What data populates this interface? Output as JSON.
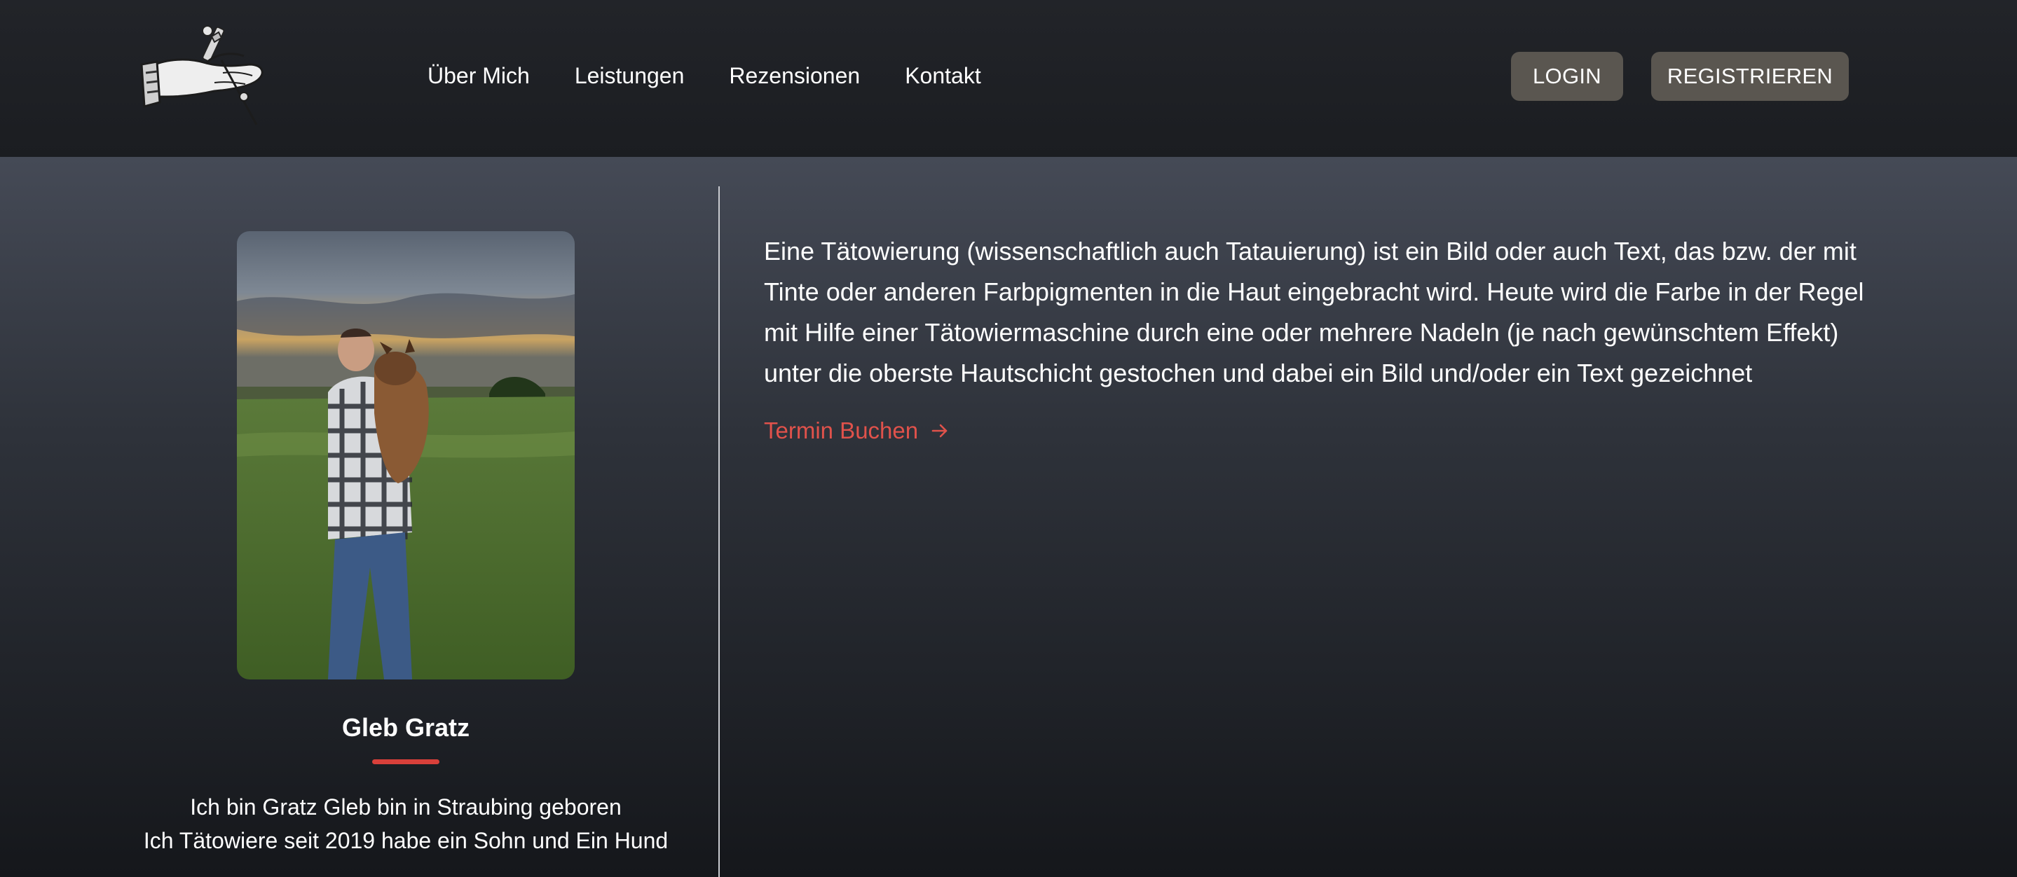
{
  "header": {
    "logo_icon": "tattoo-hand-logo-icon",
    "nav": [
      {
        "label": "Über Mich"
      },
      {
        "label": "Leistungen"
      },
      {
        "label": "Rezensionen"
      },
      {
        "label": "Kontakt"
      }
    ],
    "login_label": "LOGIN",
    "register_label": "REGISTRIEREN"
  },
  "profile": {
    "photo_icon": "artist-photo",
    "name": "Gleb Gratz",
    "bio_lines": [
      "Ich bin Gratz Gleb bin in Straubing geboren",
      "Ich Tätowiere seit 2019 habe ein Sohn und Ein Hund"
    ]
  },
  "about": {
    "lines": [
      "Eine Tätowierung (wissenschaftlich auch Tatauierung) ist ein Bild oder auch Text, das bzw. der mit",
      "Tinte oder anderen Farbpigmenten in die Haut eingebracht wird. Heute wird die Farbe in der Regel",
      "mit Hilfe einer Tätowiermaschine durch eine oder mehrere Nadeln (je nach gewünschtem Effekt)",
      "unter die oberste Hautschicht gestochen und dabei ein Bild und/oder ein Text gezeichnet"
    ],
    "cta_label": "Termin Buchen",
    "cta_icon": "arrow-right-icon"
  },
  "colors": {
    "accent": "#e0524b",
    "underline": "#d8403a",
    "button_bg": "#5a5650",
    "header_bg": "#1f2125"
  }
}
